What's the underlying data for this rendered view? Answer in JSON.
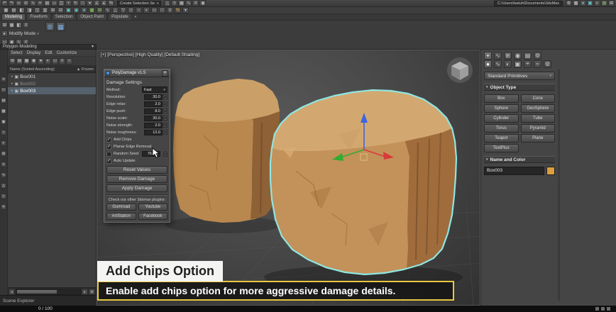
{
  "chrome": {
    "selection_set": "Create Selection Se",
    "project_path": "C:\\Users\\batuh\\Documents\\3dsMax",
    "caret": "▾"
  },
  "icons": {
    "row1": [
      {
        "name": "undo-icon",
        "glyph": "↶"
      },
      {
        "name": "redo-icon",
        "glyph": "↷"
      },
      {
        "name": "select-link-icon",
        "glyph": "∞"
      },
      {
        "name": "unlink-icon",
        "glyph": "⊘"
      },
      {
        "name": "bind-spacewarp-icon",
        "glyph": "∿"
      },
      {
        "name": "select-object-icon",
        "glyph": "⌖"
      },
      {
        "name": "select-by-name-icon",
        "glyph": "▤"
      },
      {
        "name": "selection-region-icon",
        "glyph": "▭"
      },
      {
        "name": "window-crossing-icon",
        "glyph": "◫"
      },
      {
        "name": "select-move-icon",
        "glyph": "+"
      },
      {
        "name": "select-rotate-icon",
        "glyph": "↻"
      },
      {
        "name": "select-scale-icon",
        "glyph": "□"
      },
      {
        "name": "coord-system-icon",
        "glyph": "▾"
      },
      {
        "name": "snap-toggle-icon",
        "glyph": "∠"
      },
      {
        "name": "angle-snap-icon",
        "glyph": "∡"
      },
      {
        "name": "percent-snap-icon",
        "glyph": "%"
      }
    ],
    "row1b": [
      {
        "name": "mirror-icon",
        "glyph": "△"
      },
      {
        "name": "align-icon",
        "glyph": "≡"
      },
      {
        "name": "layer-manager-icon",
        "glyph": "▦"
      },
      {
        "name": "curve-editor-icon",
        "glyph": "∿"
      },
      {
        "name": "schematic-view-icon",
        "glyph": "#"
      },
      {
        "name": "material-editor-icon",
        "glyph": "◉"
      }
    ],
    "row1c": [
      {
        "name": "render-setup-icon",
        "glyph": "⚙"
      },
      {
        "name": "render-frame-icon",
        "glyph": "▦"
      },
      {
        "name": "render-icon",
        "glyph": "●",
        "cls": "teal"
      },
      {
        "name": "toolbar-icon",
        "glyph": "▣",
        "cls": "teal"
      },
      {
        "name": "toolbar-icon",
        "glyph": "◐"
      },
      {
        "name": "toolbar-icon",
        "glyph": "▤",
        "cls": "green"
      },
      {
        "name": "toolbar-icon",
        "glyph": "⊞"
      }
    ],
    "row2": [
      {
        "name": "toolbar-icon",
        "glyph": "▦"
      },
      {
        "name": "toolbar-icon",
        "glyph": "▤"
      },
      {
        "name": "toolbar-icon",
        "glyph": "◧"
      },
      {
        "name": "toolbar-icon",
        "glyph": "◨"
      },
      {
        "name": "toolbar-icon",
        "glyph": "◫"
      },
      {
        "name": "toolbar-icon",
        "glyph": "▥"
      },
      {
        "name": "toolbar-icon",
        "glyph": "⊞"
      },
      {
        "name": "toolbar-icon",
        "glyph": "⊟"
      },
      {
        "name": "toolbar-icon",
        "glyph": "▣",
        "cls": "teal"
      },
      {
        "name": "toolbar-icon",
        "glyph": "◉",
        "cls": "teal"
      },
      {
        "name": "toolbar-icon",
        "glyph": "●",
        "cls": "teal"
      },
      {
        "name": "toolbar-icon",
        "glyph": "▦",
        "cls": "green"
      },
      {
        "name": "toolbar-icon",
        "glyph": "⊞",
        "cls": "green"
      },
      {
        "name": "toolbar-icon",
        "glyph": "∿"
      },
      {
        "name": "toolbar-icon",
        "glyph": "△"
      },
      {
        "name": "toolbar-icon",
        "glyph": "▽"
      },
      {
        "name": "toolbar-icon",
        "glyph": "◇"
      },
      {
        "name": "toolbar-icon",
        "glyph": "○"
      },
      {
        "name": "toolbar-icon",
        "glyph": "◐"
      },
      {
        "name": "toolbar-icon",
        "glyph": "▭"
      },
      {
        "name": "toolbar-icon",
        "glyph": "□"
      },
      {
        "name": "toolbar-icon",
        "glyph": "≡"
      },
      {
        "name": "toolbar-icon",
        "glyph": "%",
        "cls": "orange"
      },
      {
        "name": "toolbar-icon",
        "glyph": "▾"
      }
    ],
    "ribbon_a": [
      {
        "name": "ribbon-tool-icon",
        "glyph": "⊞"
      },
      {
        "name": "ribbon-tool-icon",
        "glyph": "▦"
      },
      {
        "name": "ribbon-tool-icon",
        "glyph": "◧"
      },
      {
        "name": "ribbon-tool-icon",
        "glyph": "≡"
      }
    ],
    "blue_pair": [
      {
        "name": "layout-grid-icon",
        "glyph": "⊞",
        "cls": "bigblue"
      },
      {
        "name": "layout-grid-icon",
        "glyph": "▦",
        "cls": "bigblue"
      }
    ],
    "ribbon_b": [
      {
        "name": "ribbon-tool-icon",
        "glyph": "▭"
      },
      {
        "name": "ribbon-tool-icon",
        "glyph": "◉"
      },
      {
        "name": "ribbon-tool-icon",
        "glyph": "∿"
      },
      {
        "name": "ribbon-tool-icon",
        "glyph": "#"
      }
    ],
    "explorer_toolbar": [
      {
        "name": "explorer-tool-icon",
        "glyph": "⊞"
      },
      {
        "name": "explorer-tool-icon",
        "glyph": "▤"
      },
      {
        "name": "explorer-tool-icon",
        "glyph": "▦"
      },
      {
        "name": "explorer-tool-icon",
        "glyph": "◉"
      },
      {
        "name": "explorer-tool-icon",
        "glyph": "●"
      },
      {
        "name": "explorer-tool-icon",
        "glyph": "◐"
      },
      {
        "name": "explorer-tool-icon",
        "glyph": "▭"
      },
      {
        "name": "explorer-tool-icon",
        "glyph": "≡"
      },
      {
        "name": "search-icon",
        "glyph": "○"
      }
    ],
    "left_strip": [
      {
        "name": "sidebar-tool-icon",
        "glyph": "⌖"
      },
      {
        "name": "sidebar-tool-icon",
        "glyph": "▭"
      },
      {
        "name": "sidebar-tool-icon",
        "glyph": "▤"
      },
      {
        "name": "sidebar-tool-icon",
        "glyph": "▦"
      },
      {
        "name": "sidebar-tool-icon",
        "glyph": "◉"
      },
      {
        "name": "sidebar-tool-icon",
        "glyph": "○"
      },
      {
        "name": "sidebar-tool-icon",
        "glyph": "◐"
      },
      {
        "name": "sidebar-tool-icon",
        "glyph": "⊞"
      },
      {
        "name": "sidebar-tool-icon",
        "glyph": "≡"
      },
      {
        "name": "sidebar-tool-icon",
        "glyph": "∿"
      },
      {
        "name": "sidebar-tool-icon",
        "glyph": "△"
      },
      {
        "name": "sidebar-tool-icon",
        "glyph": "◇"
      },
      {
        "name": "sidebar-tool-icon",
        "glyph": "#"
      }
    ],
    "panel_tabs": [
      {
        "name": "create-tab-icon",
        "glyph": "+",
        "cls": "active"
      },
      {
        "name": "modify-tab-icon",
        "glyph": "∿"
      },
      {
        "name": "hierarchy-tab-icon",
        "glyph": "⊞"
      },
      {
        "name": "motion-tab-icon",
        "glyph": "◉"
      },
      {
        "name": "display-tab-icon",
        "glyph": "▤"
      },
      {
        "name": "utilities-tab-icon",
        "glyph": "⚙"
      }
    ],
    "panel_categories": [
      {
        "name": "geometry-category-icon",
        "glyph": "●",
        "cls": "active"
      },
      {
        "name": "shapes-category-icon",
        "glyph": "∿"
      },
      {
        "name": "lights-category-icon",
        "glyph": "◐"
      },
      {
        "name": "cameras-category-icon",
        "glyph": "▣"
      },
      {
        "name": "helpers-category-icon",
        "glyph": "⌖"
      },
      {
        "name": "spacewarps-category-icon",
        "glyph": "≈"
      },
      {
        "name": "systems-category-icon",
        "glyph": "⚙"
      }
    ]
  },
  "ribbon": {
    "tabs": [
      {
        "label": "Modeling",
        "name": "tab-modeling",
        "cls": "active"
      },
      {
        "label": "Freeform",
        "name": "tab-freeform"
      },
      {
        "label": "Selection",
        "name": "tab-selection"
      },
      {
        "label": "Object Paint",
        "name": "tab-object-paint"
      },
      {
        "label": "Populate",
        "name": "tab-populate"
      }
    ],
    "modify_mode": "Modify Mode",
    "modify_icon": "▸",
    "polygon_modeling": "Polygon Modeling"
  },
  "scene_explorer": {
    "menu": [
      {
        "label": "Select",
        "name": "menu-select"
      },
      {
        "label": "Display",
        "name": "menu-display"
      },
      {
        "label": "Edit",
        "name": "menu-edit"
      },
      {
        "label": "Customize",
        "name": "menu-customize"
      }
    ],
    "name_column": "Name (Sorted Ascending)",
    "sort_arrow": "▲",
    "frozen_column": "Frozen",
    "row_arrow": "▸",
    "row_icon": "▣",
    "rows": [
      {
        "name": "Box001"
      },
      {
        "name": "Box002",
        "cls": "dim"
      },
      {
        "name": "Box003",
        "cls": "selected"
      }
    ],
    "tab_label": "Scene Explorer"
  },
  "viewport": {
    "header": "[+] [Perspective] [High Quality] [Default Shading]"
  },
  "dialog": {
    "title": "PolyDamage v1.5",
    "close_glyph": "×",
    "section": "Damage Settings",
    "method_label": "Method:",
    "method_value": "Fast",
    "settings": [
      {
        "label": "Resolution:",
        "value": "30.0"
      },
      {
        "label": "Edge relax:",
        "value": "2.0"
      },
      {
        "label": "Edge push:",
        "value": "8.0"
      },
      {
        "label": "Noise scale:",
        "value": "30.0"
      },
      {
        "label": "Noise strength:",
        "value": "2.0"
      },
      {
        "label": "Noise roughness:",
        "value": "12.0"
      }
    ],
    "checks": [
      {
        "label": "Add Chips",
        "state": "✓",
        "name": "add-chips-checkbox-row"
      },
      {
        "label": "Planar Edge Removal",
        "state": "✓",
        "name": "planar-edge-removal-checkbox-row"
      }
    ],
    "seed": {
      "label": "Random Seed",
      "value": "76369",
      "state": ""
    },
    "auto_update": {
      "label": "Auto Update",
      "state": "✓"
    },
    "buttons": [
      {
        "label": "Reset Values",
        "name": "reset-values-button"
      },
      {
        "label": "Remove Damage",
        "name": "remove-damage-button"
      },
      {
        "label": "Apply Damage",
        "name": "apply-damage-button"
      }
    ],
    "footer": "Check our other 3dsmax plugins:",
    "links": [
      {
        "label": "Gumroad",
        "name": "gumroad-link-button"
      },
      {
        "label": "Youtube",
        "name": "youtube-link-button"
      },
      {
        "label": "ArtStation",
        "name": "artstation-link-button"
      },
      {
        "label": "Facebook",
        "name": "facebook-link-button"
      }
    ]
  },
  "command_panel": {
    "dropdown_value": "Standard Primitives",
    "rollout_arrow": "▾",
    "object_type_title": "Object Type",
    "object_buttons": [
      {
        "label": "Box",
        "name": "box-button"
      },
      {
        "label": "Cone",
        "name": "cone-button"
      },
      {
        "label": "Sphere",
        "name": "sphere-button"
      },
      {
        "label": "GeoSphere",
        "name": "geosphere-button"
      },
      {
        "label": "Cylinder",
        "name": "cylinder-button"
      },
      {
        "label": "Tube",
        "name": "tube-button"
      },
      {
        "label": "Torus",
        "name": "torus-button"
      },
      {
        "label": "Pyramid",
        "name": "pyramid-button"
      },
      {
        "label": "Teapot",
        "name": "teapot-button"
      },
      {
        "label": "Plane",
        "name": "plane-button"
      },
      {
        "label": "TextPlus",
        "name": "textplus-button"
      }
    ],
    "name_color_title": "Name and Color",
    "object_name": "Box003"
  },
  "caption": {
    "title": "Add Chips Option",
    "subtitle": "Enable add chips option for more aggressive damage details."
  },
  "status": {
    "frame_display": "0 / 100"
  },
  "colors": {
    "caption_accent": "#e9c83f",
    "selection_outline": "#8fe6e2",
    "object_color": "#c3915a",
    "name_swatch": "#dd9f3c"
  }
}
